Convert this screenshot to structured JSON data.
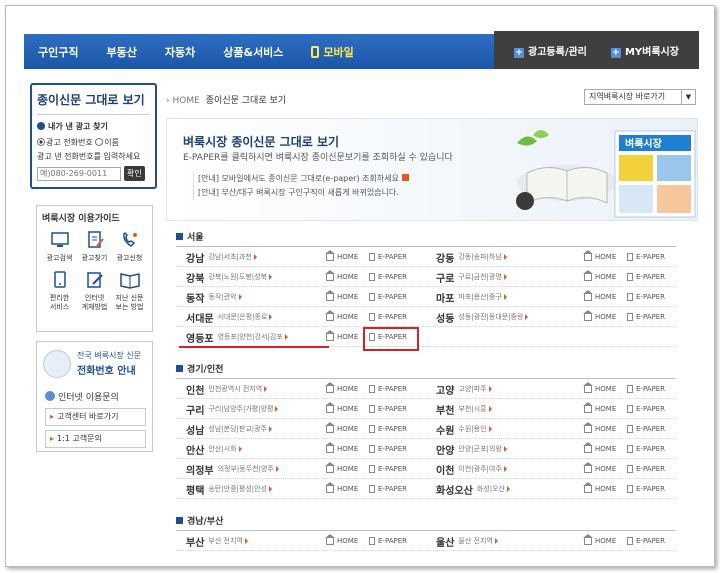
{
  "topnav": {
    "items": [
      "구인구직",
      "부동산",
      "자동차",
      "상품&서비스"
    ],
    "mobile": "모바일",
    "right": [
      "광고등록/관리",
      "MY벼룩시장"
    ]
  },
  "sidebar": {
    "paper_title": "종이신문 그대로 보기",
    "find_ad": "내가 낸 광고 찾기",
    "radio_phone": "광고 전화번호",
    "radio_name": "이름",
    "hint": "광고 낸 전화번호를 입력하세요",
    "phone_placeholder": "예)080-269-0011",
    "confirm": "확인",
    "guide_title": "벼룩시장 이용가이드",
    "guide_items": [
      [
        "광고검색"
      ],
      [
        "광고찾기"
      ],
      [
        "광고신청"
      ],
      [
        "편리한",
        "서비스"
      ],
      [
        "인터넷",
        "게재방법"
      ],
      [
        "지난 신문",
        "보는 방법"
      ]
    ],
    "national_line1": "전국 벼룩시장 신문",
    "national_line2": "전화번호 안내",
    "inquiry": "인터넷 이용문의",
    "links": [
      "고객센터 바로가기",
      "1:1 고객문의"
    ]
  },
  "breadcrumb": {
    "home": "HOME",
    "current": "종이신문 그대로 보기"
  },
  "region_select": "지역벼룩시장 바로가기",
  "banner": {
    "title": "벼룩시장 종이신문 그대로 보기",
    "subtitle": "E-PAPER를 클릭하시면 벼룩시장 종이신문보기를 조회하실 수 있습니다",
    "info1": "[안내] 모바일에서도 종이신문 그대로(e-paper) 조회하세요",
    "info2": "[안내] 부산/대구 벼룩시장 구인구직이 새롭게 바뀌었습니다.",
    "paper_logo": "벼룩시장"
  },
  "labels": {
    "home": "HOME",
    "epaper": "E-PAPER"
  },
  "sections": [
    {
      "title": "서울",
      "rows": [
        [
          {
            "name": "강남",
            "sub": "강남|서초|과천"
          },
          {
            "name": "강동",
            "sub": "강동|송파|하남"
          }
        ],
        [
          {
            "name": "강북",
            "sub": "강북|노원|도봉|성북"
          },
          {
            "name": "구로",
            "sub": "구로|금천|광명"
          }
        ],
        [
          {
            "name": "동작",
            "sub": "동작|관악"
          },
          {
            "name": "마포",
            "sub": "마포|용산|중구"
          }
        ],
        [
          {
            "name": "서대문",
            "sub": "서대문|은평|종로"
          },
          {
            "name": "성동",
            "sub": "성동|광진|동대문|중랑"
          }
        ],
        [
          {
            "name": "영등포",
            "sub": "영등포|양천|강서|김포"
          }
        ]
      ]
    },
    {
      "title": "경기/인천",
      "rows": [
        [
          {
            "name": "인천",
            "sub": "인천광역시 전지역"
          },
          {
            "name": "고양",
            "sub": "고양|파주"
          }
        ],
        [
          {
            "name": "구리",
            "sub": "구리|남양주|가평|양평"
          },
          {
            "name": "부천",
            "sub": "부천|시흥"
          }
        ],
        [
          {
            "name": "성남",
            "sub": "성남|분당|판교|광주"
          },
          {
            "name": "수원",
            "sub": "수원|용인"
          }
        ],
        [
          {
            "name": "안산",
            "sub": "안산|시화"
          },
          {
            "name": "안양",
            "sub": "안양|군포|의왕"
          }
        ],
        [
          {
            "name": "의정부",
            "sub": "의정부|동두천|양주"
          },
          {
            "name": "이천",
            "sub": "이천|광주|여주"
          }
        ],
        [
          {
            "name": "평택",
            "sub": "송탄|안중|평성|안성"
          },
          {
            "name": "화성오산",
            "sub": "화성|오산"
          }
        ]
      ]
    },
    {
      "title": "경남/부산",
      "rows": [
        [
          {
            "name": "부산",
            "sub": "부산 전지역"
          },
          {
            "name": "울산",
            "sub": "울산 전지역"
          }
        ]
      ]
    }
  ]
}
